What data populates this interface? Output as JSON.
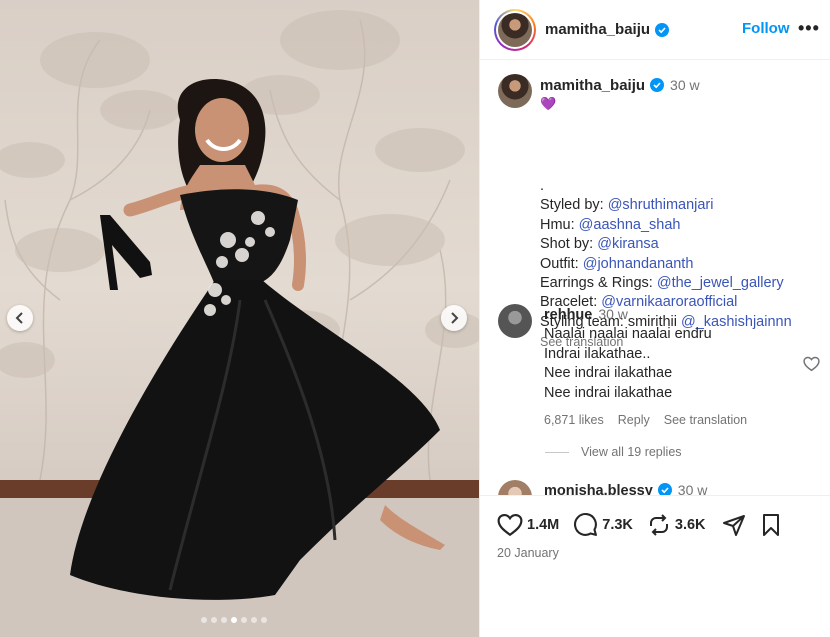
{
  "post": {
    "username": "mamitha_baiju",
    "follow_label": "Follow",
    "more_label": "•••",
    "carousel": {
      "total_slides": 7,
      "active_slide": 4
    }
  },
  "caption": {
    "username": "mamitha_baiju",
    "time": "30 w",
    "emoji": "💜",
    "lines": [
      {
        "label": ".",
        "mention": ""
      },
      {
        "label": "Styled by: ",
        "mention": "@shruthimanjari"
      },
      {
        "label": "Hmu: ",
        "mention": "@aashna_shah"
      },
      {
        "label": "Shot by: ",
        "mention": "@kiransa"
      },
      {
        "label": "Outfit: ",
        "mention": "@johnandananth"
      },
      {
        "label": "Earrings & Rings: ",
        "mention": "@the_jewel_gallery"
      },
      {
        "label": "Bracelet: ",
        "mention": "@varnikaaroraofficial"
      },
      {
        "label": "Styling team: smirithii ",
        "mention": "@_kashishjainnn"
      }
    ],
    "see_translation": "See translation"
  },
  "comments": [
    {
      "username": "rehhue",
      "time": "30 w",
      "lines": [
        "Naalai naalai naalai endru",
        "Indrai ilakathae..",
        "Nee indrai ilakathae",
        "Nee indrai ilakathae"
      ],
      "likes": "6,871 likes",
      "reply": "Reply",
      "see_translation": "See translation",
      "view_replies": "View all 19 replies"
    },
    {
      "username": "monisha.blessy",
      "time": "30 w"
    }
  ],
  "footer": {
    "likes": "1.4M",
    "comments": "7.3K",
    "reposts": "3.6K",
    "date": "20 January"
  },
  "colors": {
    "accent": "#0095f6",
    "mention": "#3a55b8",
    "muted": "#737373",
    "verified": "#0095f6"
  }
}
